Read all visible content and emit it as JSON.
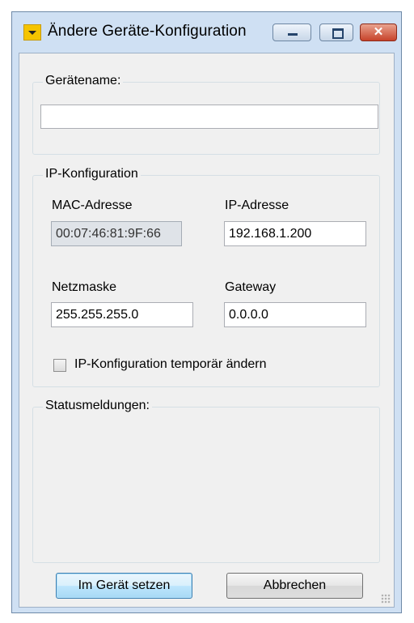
{
  "window": {
    "title": "Ändere Geräte-Konfiguration",
    "controls": {
      "minimize": "minimize",
      "maximize": "maximize",
      "close": "✕"
    }
  },
  "device_name": {
    "group_title": "Gerätename:",
    "value": ""
  },
  "ip_config": {
    "group_title": "IP-Konfiguration",
    "mac_label": "MAC-Adresse",
    "mac_value": "00:07:46:81:9F:66",
    "ip_label": "IP-Adresse",
    "ip_value": "192.168.1.200",
    "netmask_label": "Netzmaske",
    "netmask_value": "255.255.255.0",
    "gateway_label": "Gateway",
    "gateway_value": "0.0.0.0",
    "temp_checkbox_label": "IP-Konfiguration temporär ändern",
    "temp_checkbox_checked": false
  },
  "status": {
    "group_title": "Statusmeldungen:"
  },
  "buttons": {
    "apply_label": "Im Gerät setzen",
    "cancel_label": "Abbrechen"
  },
  "colors": {
    "frame": "#cfe0f3",
    "close_button": "#c7432b",
    "default_button_border": "#3c7fb1",
    "app_icon": "#f5c400"
  }
}
